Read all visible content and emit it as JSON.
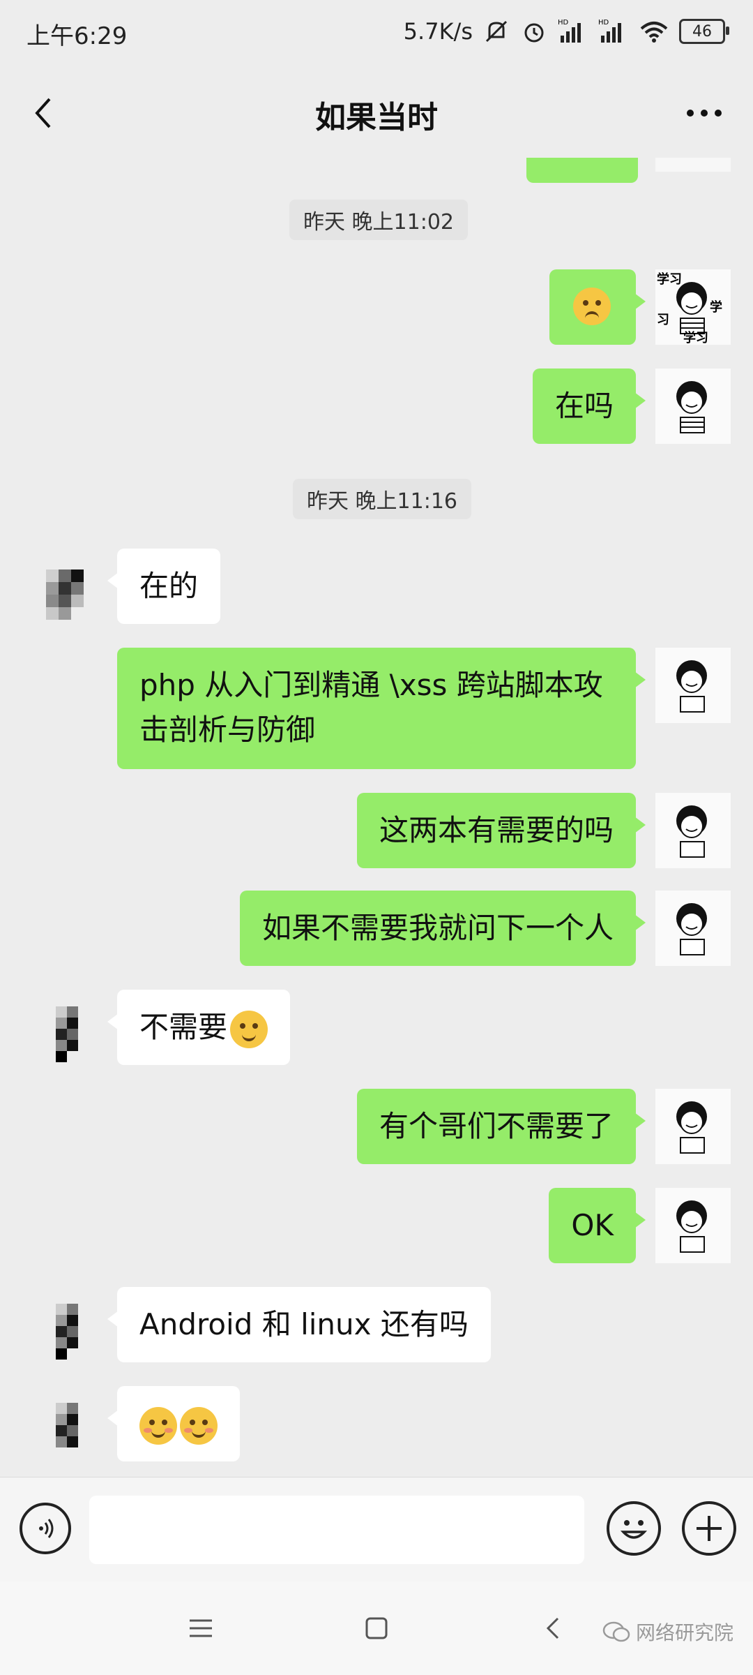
{
  "status_bar": {
    "time": "上午6:29",
    "net_speed": "5.7K/s",
    "signal_1_label": "HD",
    "signal_2_label": "HD",
    "battery": "46"
  },
  "header": {
    "title": "如果当时"
  },
  "messages": [
    {
      "type": "timestamp",
      "text": "昨天 晚上11:02"
    },
    {
      "type": "sent",
      "emoji": "pleading-face"
    },
    {
      "type": "sent",
      "text": "在吗"
    },
    {
      "type": "timestamp",
      "text": "昨天 晚上11:16"
    },
    {
      "type": "received",
      "text": "在的"
    },
    {
      "type": "sent",
      "text": "php 从入门到精通 \\xss 跨站脚本攻击剖析与防御"
    },
    {
      "type": "sent",
      "text": "这两本有需要的吗"
    },
    {
      "type": "sent",
      "text": "如果不需要我就问下一个人"
    },
    {
      "type": "received",
      "text": "不需要",
      "emoji": "facepalm-laughing"
    },
    {
      "type": "sent",
      "text": "有个哥们不需要了"
    },
    {
      "type": "sent",
      "text": "OK"
    },
    {
      "type": "received",
      "text": "Android 和 linux 还有吗"
    },
    {
      "type": "received",
      "emoji": "blushing-smile x2"
    }
  ],
  "avatar": {
    "sent_text_1": "学习",
    "sent_text_2": "学",
    "sent_text_3": "习",
    "sent_text_4": "学习"
  },
  "input_bar": {
    "placeholder": ""
  },
  "watermark": "网络研究院",
  "colors": {
    "sent_bubble": "#95ec69",
    "received_bubble": "#ffffff",
    "background": "#ededed"
  }
}
